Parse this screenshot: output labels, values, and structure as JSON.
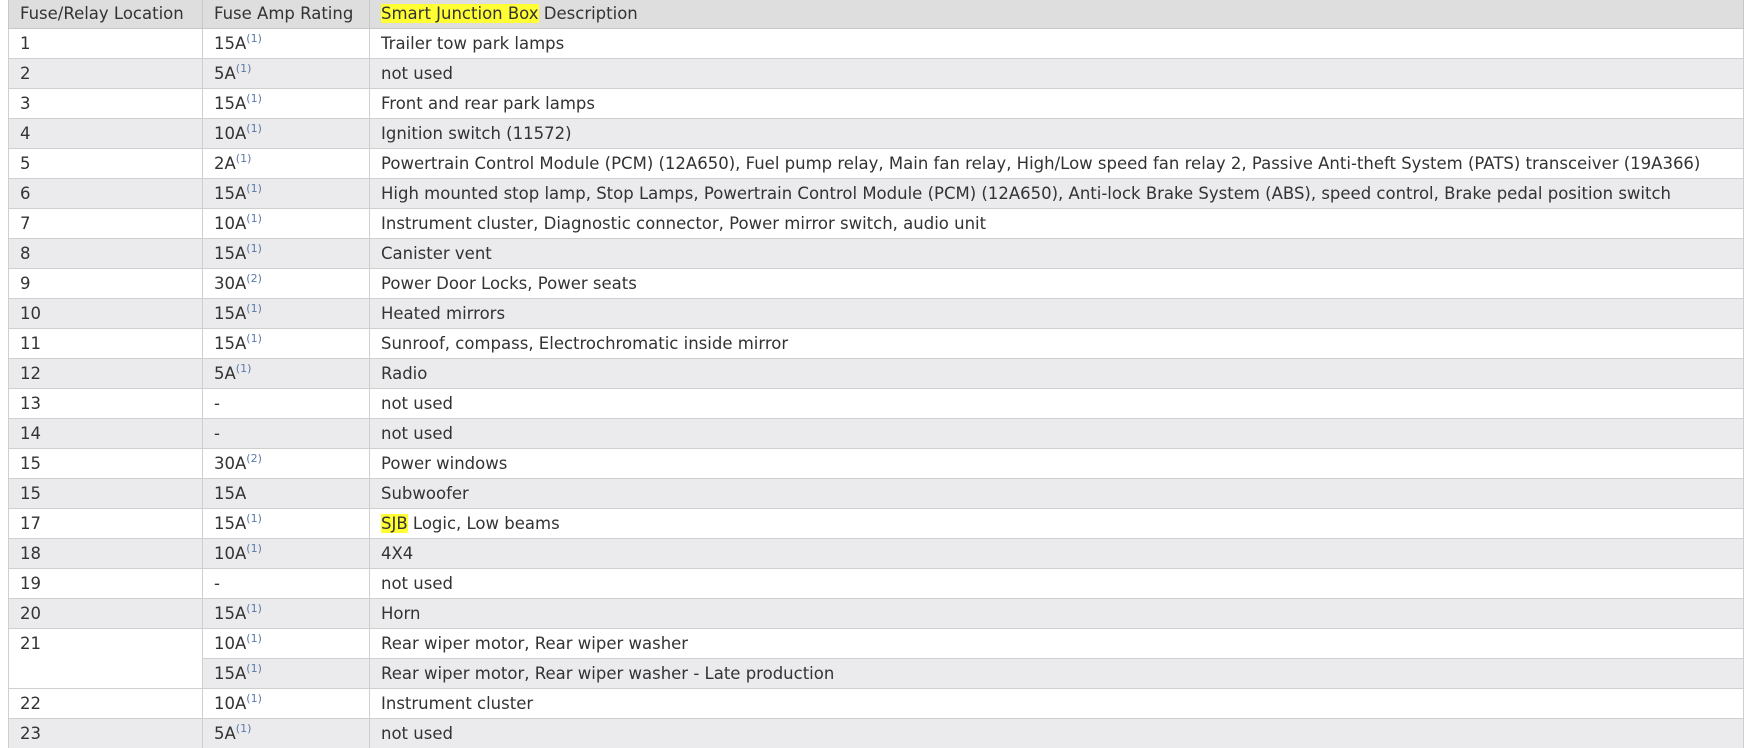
{
  "header": {
    "location": "Fuse/Relay Location",
    "amp": "Fuse Amp Rating",
    "desc_highlight": "Smart Junction Box",
    "desc_rest": " Description"
  },
  "rows": [
    {
      "loc": "1",
      "amp": "15A",
      "note": "(1)",
      "desc": "Trailer tow park lamps"
    },
    {
      "loc": "2",
      "amp": "5A",
      "note": "(1)",
      "desc": "not used"
    },
    {
      "loc": "3",
      "amp": "15A",
      "note": "(1)",
      "desc": "Front and rear park lamps"
    },
    {
      "loc": "4",
      "amp": "10A",
      "note": "(1)",
      "desc": "Ignition switch (11572)"
    },
    {
      "loc": "5",
      "amp": "2A",
      "note": "(1)",
      "desc": "Powertrain Control Module (PCM) (12A650), Fuel pump relay, Main fan relay, High/Low speed fan relay 2, Passive Anti-theft System (PATS) transceiver (19A366)"
    },
    {
      "loc": "6",
      "amp": "15A",
      "note": "(1)",
      "desc": "High mounted stop lamp, Stop Lamps, Powertrain Control Module (PCM) (12A650), Anti-lock Brake System (ABS), speed control, Brake pedal position switch"
    },
    {
      "loc": "7",
      "amp": "10A",
      "note": "(1)",
      "desc": "Instrument cluster, Diagnostic connector, Power mirror switch, audio unit"
    },
    {
      "loc": "8",
      "amp": "15A",
      "note": "(1)",
      "desc": "Canister vent"
    },
    {
      "loc": "9",
      "amp": "30A",
      "note": "(2)",
      "desc": "Power Door Locks, Power seats"
    },
    {
      "loc": "10",
      "amp": "15A",
      "note": "(1)",
      "desc": "Heated mirrors"
    },
    {
      "loc": "11",
      "amp": "15A",
      "note": "(1)",
      "desc": "Sunroof, compass, Electrochromatic inside mirror"
    },
    {
      "loc": "12",
      "amp": "5A",
      "note": "(1)",
      "desc": "Radio"
    },
    {
      "loc": "13",
      "amp": "-",
      "note": "",
      "desc": "not used"
    },
    {
      "loc": "14",
      "amp": "-",
      "note": "",
      "desc": "not used"
    },
    {
      "loc": "15",
      "amp": "30A",
      "note": "(2)",
      "desc": "Power windows"
    },
    {
      "loc": "15",
      "amp": "15A",
      "note": "",
      "desc": "Subwoofer"
    },
    {
      "loc": "17",
      "amp": "15A",
      "note": "(1)",
      "desc_highlight": "SJB",
      "desc": " Logic, Low beams"
    },
    {
      "loc": "18",
      "amp": "10A",
      "note": "(1)",
      "desc": "4X4"
    },
    {
      "loc": "19",
      "amp": "-",
      "note": "",
      "desc": "not used"
    },
    {
      "loc": "20",
      "amp": "15A",
      "note": "(1)",
      "desc": "Horn"
    },
    {
      "loc": "21",
      "amp": "10A",
      "note": "(1)",
      "desc": "Rear wiper motor, Rear wiper washer"
    },
    {
      "amp": "15A",
      "note": "(1)",
      "desc": "Rear wiper motor, Rear wiper washer - Late production"
    },
    {
      "loc": "22",
      "amp": "10A",
      "note": "(1)",
      "desc": "Instrument cluster"
    },
    {
      "loc": "23",
      "amp": "5A",
      "note": "(1)",
      "desc": "not used"
    }
  ]
}
